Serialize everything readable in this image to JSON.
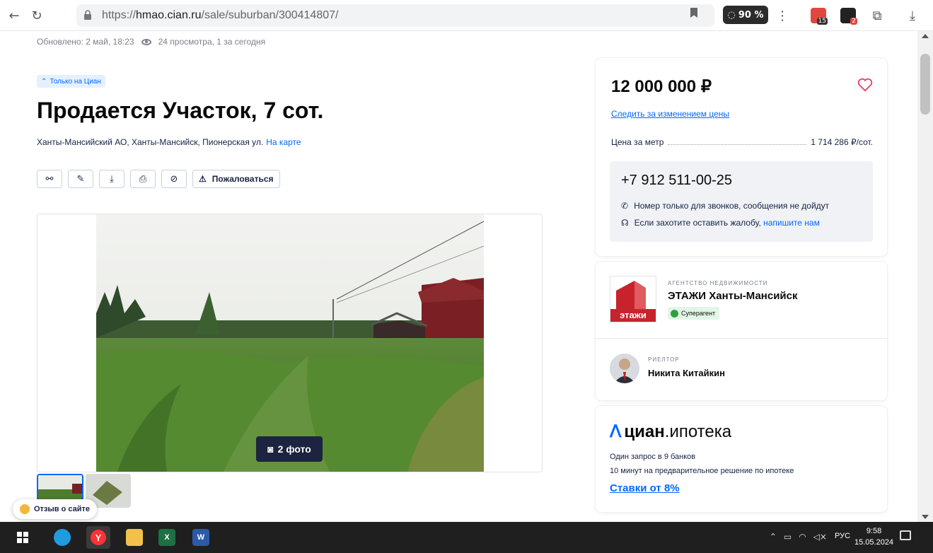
{
  "browser": {
    "url_prefix": "https://",
    "url_host": "hmao.cian.ru",
    "url_path": "/sale/suburban/300414807/",
    "zoom": "90 %",
    "ext_badge_1": "15",
    "ext_badge_2": "2",
    "icons": [
      "back-icon",
      "reload-icon",
      "lock-icon",
      "bookmark-icon",
      "zoom-icon",
      "menu-icon",
      "download-icon"
    ]
  },
  "listing": {
    "updated": "Обновлено: 2 май, 18:23",
    "views": "24 просмотра, 1 за сегодня",
    "only_badge": "Только на Циан",
    "title": "Продается Участок, 7 сот.",
    "address": "Ханты-Мансийский АО, Ханты-Мансийск, Пионерская ул.",
    "map_link": "На карте",
    "report_label": "Пожаловаться",
    "photo_count": "2 фото",
    "feedback": "Отзыв о сайте"
  },
  "price_card": {
    "price": "12 000 000 ₽",
    "track_link": "Следить за изменением цены",
    "ppm_label": "Цена за метр",
    "ppm_value": "1 714 286 ₽/сот.",
    "phone": "+7 912 511-00-25",
    "note_calls": "Номер только для звонков, сообщения не дойдут",
    "note_complaint": "Если захотите оставить жалобу,",
    "note_link": "напишите нам"
  },
  "agent_card": {
    "agency_label": "АГЕНТСТВО НЕДВИЖИМОСТИ",
    "agency_name": "ЭТАЖИ Ханты-Мансийск",
    "agency_logo_text": "этажи",
    "super_badge": "Суперагент",
    "realtor_label": "РИЕЛТОР",
    "realtor_name": "Никита Китайкин"
  },
  "mortgage_card": {
    "logo_bold": "циан",
    "logo_rest": ".ипотека",
    "line1": "Один запрос в 9 банков",
    "line2": "10 минут на предварительное решение по ипотеке",
    "rates": "Ставки от 8%"
  },
  "taskbar": {
    "lang": "РУС",
    "time": "9:58",
    "date": "15.05.2024"
  },
  "colors": {
    "accent": "#0468ff",
    "brand_red": "#c8232c",
    "heart": "#e84260"
  }
}
